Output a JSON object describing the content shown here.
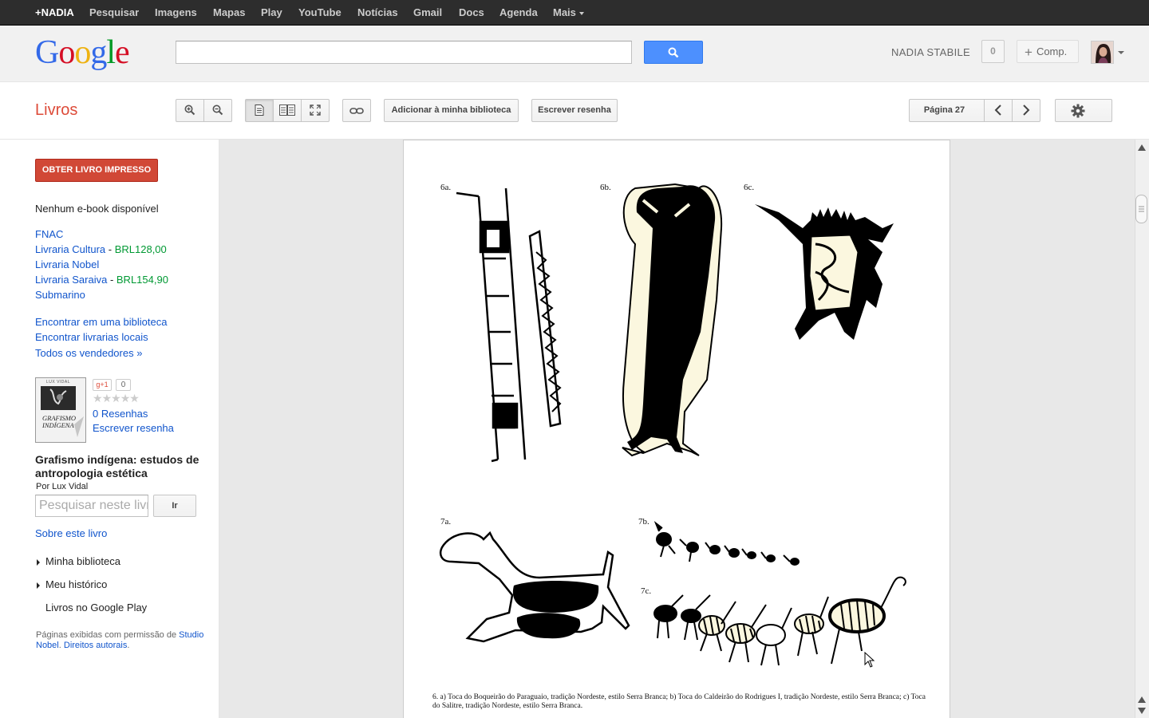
{
  "topbar": {
    "items": [
      "+NADIA",
      "Pesquisar",
      "Imagens",
      "Mapas",
      "Play",
      "YouTube",
      "Notícias",
      "Gmail",
      "Docs",
      "Agenda",
      "Mais"
    ]
  },
  "header": {
    "logo": "Google",
    "search_value": "",
    "username": "NADIA STABILE",
    "notification_count": "0",
    "share_label": "Comp."
  },
  "toolbar": {
    "section_title": "Livros",
    "add_library_label": "Adicionar à minha biblioteca",
    "write_review_label": "Escrever resenha",
    "page_label": "Página 27"
  },
  "sidebar": {
    "buy_print_label": "OBTER LIVRO IMPRESSO",
    "no_ebook": "Nenhum e-book disponível",
    "stores": [
      {
        "name": "FNAC",
        "price": ""
      },
      {
        "name": "Livraria Cultura",
        "price": "BRL128,00"
      },
      {
        "name": "Livraria Nobel",
        "price": ""
      },
      {
        "name": "Livraria Saraiva",
        "price": "BRL154,90"
      },
      {
        "name": "Submarino",
        "price": ""
      }
    ],
    "find_library": "Encontrar em uma biblioteca",
    "find_local": "Encontrar livrarias locais",
    "all_sellers": "Todos os vendedores »",
    "gplus_label": "+1",
    "gplus_count": "0",
    "reviews_count": "0 Resenhas",
    "write_review": "Escrever resenha",
    "book_title": "Grafismo indígena: estudos de antropologia estética",
    "author": "Por Lux Vidal",
    "search_in_placeholder": "Pesquisar neste livro",
    "go_label": "Ir",
    "about_book": "Sobre este livro",
    "my_library": "Minha biblioteca",
    "my_history": "Meu histórico",
    "books_play": "Livros no Google Play",
    "permission_text": "Páginas exibidas com permissão de",
    "publisher": "Studio Nobel",
    "copyright": "Direitos autorais",
    "cover_top": "LUX VIDAL",
    "cover_title": "GRAFISMO INDÍGENA"
  },
  "book_page": {
    "labels": [
      "6a.",
      "6b.",
      "6c.",
      "7a.",
      "7b.",
      "7c."
    ],
    "caption": "6. a) Toca do Boqueirão do Paraguaio, tradição Nordeste, estilo Serra Branca; b) Toca do Caldeirão do Rodrigues I, tradição Nordeste, estilo Serra Branca; c) Toca do Salitre, tradição Nordeste, estilo Serra Branca."
  },
  "colors": {
    "topbar_bg": "#2d2d2d",
    "accent_red": "#dd4b39",
    "search_blue": "#4d90fe",
    "link_blue": "#1155cc",
    "price_green": "#009933"
  }
}
